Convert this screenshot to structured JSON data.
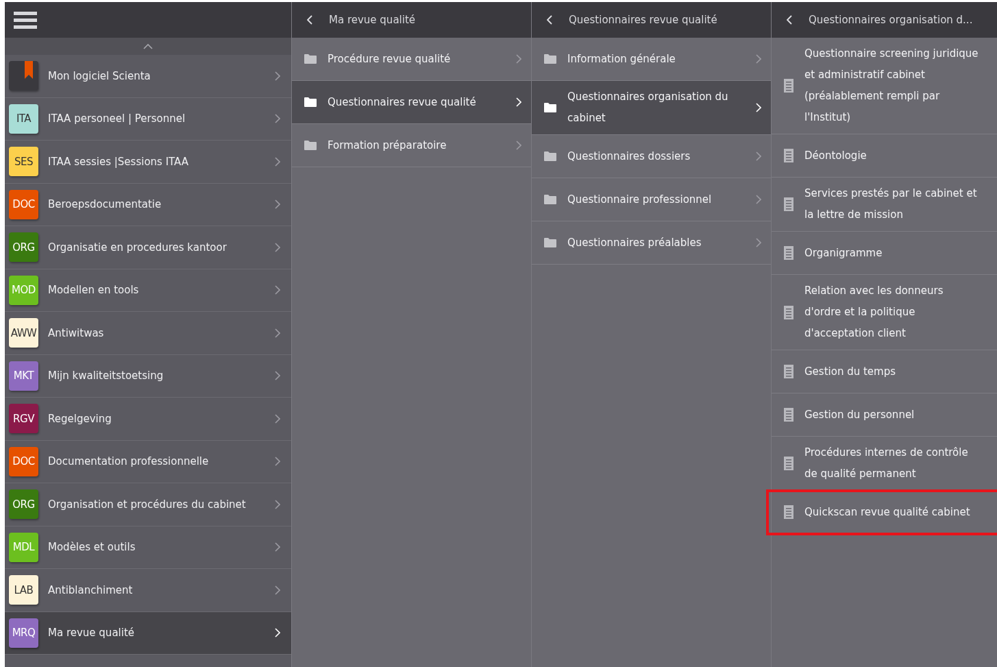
{
  "sidebar": {
    "items": [
      {
        "kind": "bookmark",
        "label": "Mon logiciel Scienta",
        "color": "#3a393e",
        "selected": false
      },
      {
        "kind": "badge",
        "badge": "ITA",
        "label": "ITAA personeel | Personnel",
        "color": "#a8ddd6",
        "selected": false
      },
      {
        "kind": "badge",
        "badge": "SES",
        "label": "ITAA sessies |Sessions ITAA",
        "color": "#fcd04c",
        "selected": false
      },
      {
        "kind": "badge",
        "badge": "DOC",
        "label": "Beroepsdocumentatie",
        "color": "#e65100",
        "selected": false
      },
      {
        "kind": "badge",
        "badge": "ORG",
        "label": "Organisatie en procedures kantoor",
        "color": "#3a7a10",
        "selected": false
      },
      {
        "kind": "badge",
        "badge": "MOD",
        "label": "Modellen en tools",
        "color": "#6cbf1f",
        "selected": false
      },
      {
        "kind": "badge",
        "badge": "AWW",
        "label": "Antiwitwas",
        "color": "#fdf3d8",
        "selected": false
      },
      {
        "kind": "badge",
        "badge": "MKT",
        "label": "Mijn kwaliteitstoetsing",
        "color": "#8e6bbf",
        "selected": false
      },
      {
        "kind": "badge",
        "badge": "RGV",
        "label": "Regelgeving",
        "color": "#8b1a4a",
        "selected": false
      },
      {
        "kind": "badge",
        "badge": "DOC",
        "label": "Documentation professionnelle",
        "color": "#e65100",
        "selected": false
      },
      {
        "kind": "badge",
        "badge": "ORG",
        "label": "Organisation et procédures du cabinet",
        "color": "#3a7a10",
        "selected": false
      },
      {
        "kind": "badge",
        "badge": "MDL",
        "label": "Modèles et outils",
        "color": "#6cbf1f",
        "selected": false
      },
      {
        "kind": "badge",
        "badge": "LAB",
        "label": "Antiblanchiment",
        "color": "#fdf3d8",
        "selected": false
      },
      {
        "kind": "badge",
        "badge": "MRQ",
        "label": "Ma revue qualité",
        "color": "#8e6bbf",
        "selected": true
      }
    ]
  },
  "columns": [
    {
      "back_label": "Ma revue qualité",
      "items": [
        {
          "kind": "folder",
          "label": "Procédure revue qualité",
          "selected": false,
          "highlighted": false
        },
        {
          "kind": "folder",
          "label": "Questionnaires revue qualité",
          "selected": true,
          "highlighted": false
        },
        {
          "kind": "folder",
          "label": "Formation préparatoire",
          "selected": false,
          "highlighted": false
        }
      ]
    },
    {
      "back_label": "Questionnaires revue qualité",
      "items": [
        {
          "kind": "folder",
          "label": "Information générale",
          "selected": false,
          "highlighted": false
        },
        {
          "kind": "folder",
          "label": "Questionnaires organisation du cabinet",
          "selected": true,
          "highlighted": false
        },
        {
          "kind": "folder",
          "label": "Questionnaires dossiers",
          "selected": false,
          "highlighted": false
        },
        {
          "kind": "folder",
          "label": "Questionnaire professionnel",
          "selected": false,
          "highlighted": false
        },
        {
          "kind": "folder",
          "label": "Questionnaires préalables",
          "selected": false,
          "highlighted": false
        }
      ]
    },
    {
      "back_label": "Questionnaires organisation d...",
      "items": [
        {
          "kind": "document",
          "label": "Questionnaire screening juridique et administratif cabinet (préalablement rempli par l'Institut)",
          "selected": false,
          "highlighted": false
        },
        {
          "kind": "document",
          "label": "Déontologie",
          "selected": false,
          "highlighted": false
        },
        {
          "kind": "document",
          "label": "Services prestés par le cabinet et la lettre de mission",
          "selected": false,
          "highlighted": false
        },
        {
          "kind": "document",
          "label": "Organigramme",
          "selected": false,
          "highlighted": false
        },
        {
          "kind": "document",
          "label": "Relation avec les donneurs d'ordre et la politique d'acceptation client",
          "selected": false,
          "highlighted": false
        },
        {
          "kind": "document",
          "label": "Gestion du temps",
          "selected": false,
          "highlighted": false
        },
        {
          "kind": "document",
          "label": "Gestion du personnel",
          "selected": false,
          "highlighted": false
        },
        {
          "kind": "document",
          "label": "Procédures internes de contrôle de qualité permanent",
          "selected": false,
          "highlighted": false
        },
        {
          "kind": "document",
          "label": "Quickscan revue qualité cabinet",
          "selected": false,
          "highlighted": true
        }
      ]
    }
  ]
}
